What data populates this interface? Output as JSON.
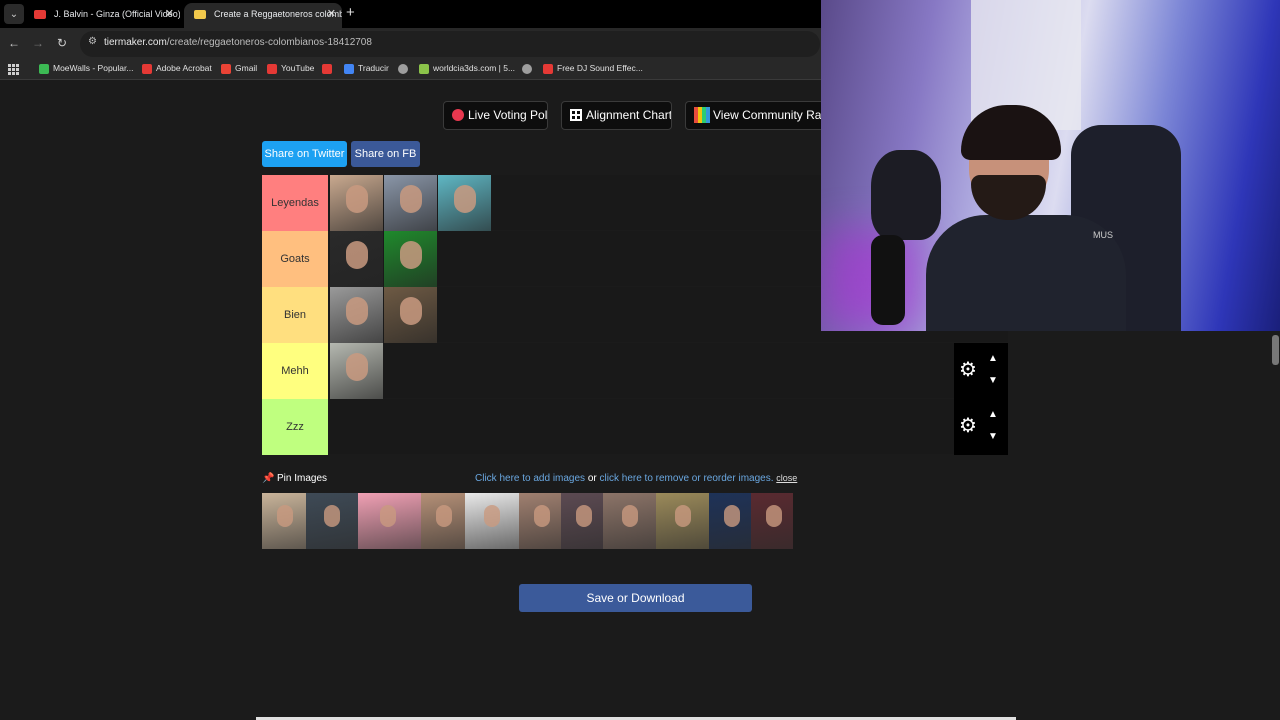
{
  "browser": {
    "tabs": [
      {
        "title": "J. Balvin - Ginza (Official Video)",
        "favicon_color": "#e53935"
      },
      {
        "title": "Create a Reggaetoneros colombianos",
        "favicon_color": "#f2c94c"
      }
    ],
    "url_host": "tiermaker.com",
    "url_path": "/create/reggaetoneros-colombianos-18412708",
    "bookmarks": [
      {
        "label": "MoeWalls - Popular...",
        "color": "#3cba54"
      },
      {
        "label": "Adobe Acrobat",
        "color": "#e53935"
      },
      {
        "label": "Gmail",
        "color": "#ea4335"
      },
      {
        "label": "YouTube",
        "color": "#e53935"
      },
      {
        "label": "",
        "color": "#e53935"
      },
      {
        "label": "Traducir",
        "color": "#4285f4"
      },
      {
        "label": "",
        "color": "#9e9e9e"
      },
      {
        "label": "worldcia3ds.com | 5...",
        "color": "#8bc34a"
      },
      {
        "label": "",
        "color": "#9e9e9e"
      },
      {
        "label": "Free DJ Sound Effec...",
        "color": "#e53935"
      }
    ]
  },
  "page": {
    "buttons": {
      "live_voting": "Live Voting Poll",
      "alignment": "Alignment Chart",
      "community": "View Community Rank",
      "share_twitter": "Share on Twitter",
      "share_fb": "Share on FB",
      "save": "Save or Download"
    },
    "tiers": [
      {
        "label": "Leyendas",
        "color": "#ff7f7f",
        "images": [
          "#c9a98f",
          "#8a96a8",
          "#5fb7c4"
        ]
      },
      {
        "label": "Goats",
        "color": "#ffbf7f",
        "images": [
          "#2a2a2a",
          "#1f8a2c"
        ]
      },
      {
        "label": "Bien",
        "color": "#ffdf7f",
        "images": [
          "#9a9a9a",
          "#6e5a44"
        ]
      },
      {
        "label": "Mehh",
        "color": "#ffff7f",
        "images": [
          "#b5b8b0"
        ]
      },
      {
        "label": "Zzz",
        "color": "#bfff7f",
        "images": []
      }
    ],
    "pin": {
      "label": "Pin Images",
      "link_add": "Click here to add images",
      "or_text": "or",
      "link_remove": "click here to remove or reorder images.",
      "close": "close"
    },
    "pool_images": [
      "#c9b49a",
      "#3e4a56",
      "#f0a0b4",
      "#b59077",
      "#e9e9e9",
      "#a08070",
      "#5c4a52",
      "#8c7468",
      "#9b8a5a",
      "#1e3258",
      "#5a2a30"
    ]
  },
  "webcam": {
    "overlay_text": "MUS"
  }
}
